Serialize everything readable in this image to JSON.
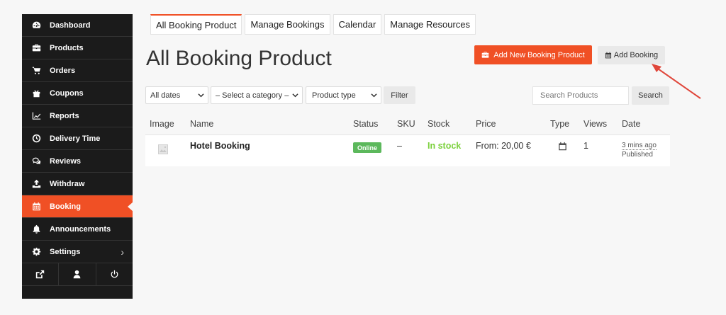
{
  "sidebar": {
    "items": [
      {
        "label": "Dashboard",
        "icon": "dashboard-icon"
      },
      {
        "label": "Products",
        "icon": "briefcase-icon"
      },
      {
        "label": "Orders",
        "icon": "cart-icon"
      },
      {
        "label": "Coupons",
        "icon": "gift-icon"
      },
      {
        "label": "Reports",
        "icon": "line-chart-icon"
      },
      {
        "label": "Delivery Time",
        "icon": "clock-icon"
      },
      {
        "label": "Reviews",
        "icon": "comments-icon"
      },
      {
        "label": "Withdraw",
        "icon": "upload-icon"
      },
      {
        "label": "Booking",
        "icon": "calendar-icon"
      },
      {
        "label": "Announcements",
        "icon": "bell-icon"
      },
      {
        "label": "Settings",
        "icon": "gear-icon"
      }
    ],
    "active_item": "Booking",
    "settings_chevron": "›"
  },
  "tabs": [
    {
      "label": "All Booking Product"
    },
    {
      "label": "Manage Bookings"
    },
    {
      "label": "Calendar"
    },
    {
      "label": "Manage Resources"
    }
  ],
  "page": {
    "title": "All Booking Product",
    "add_new_label": "Add New Booking Product",
    "add_booking_label": "Add Booking"
  },
  "filters": {
    "dates": "All dates",
    "category": "– Select a category –",
    "product_type": "Product type",
    "filter_button": "Filter",
    "search_placeholder": "Search Products",
    "search_button": "Search"
  },
  "table": {
    "headers": [
      "Image",
      "Name",
      "Status",
      "SKU",
      "Stock",
      "Price",
      "Type",
      "Views",
      "Date"
    ],
    "rows": [
      {
        "name": "Hotel Booking",
        "status": "Online",
        "sku": "–",
        "stock": "In stock",
        "price": "From: 20,00 €",
        "type_icon": "calendar-icon",
        "views": "1",
        "date": "3 mins ago",
        "date_status": "Published"
      }
    ]
  },
  "colors": {
    "accent": "#f05025",
    "sidebar_bg": "#1b1b1b",
    "online_badge": "#5cb85c",
    "in_stock": "#7ad03a",
    "arrow": "#e0463a"
  }
}
